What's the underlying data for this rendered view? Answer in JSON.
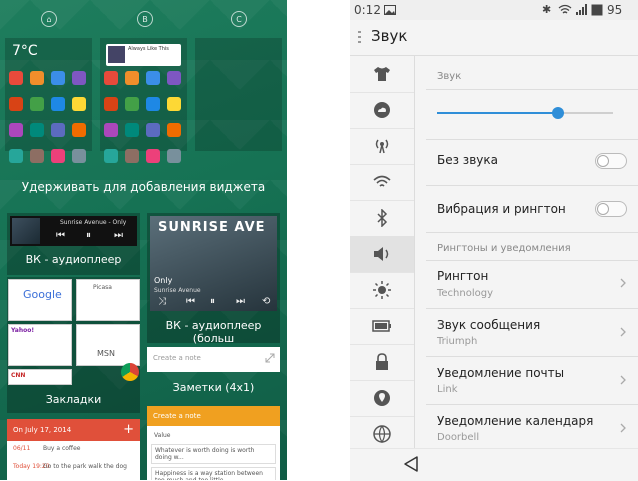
{
  "launcher": {
    "screens": [
      "⌂",
      "B",
      "C"
    ],
    "home_clock": "7°C",
    "mini_widget_text": "Always Like This",
    "hold_hint": "Удерживать для добавления виджета",
    "vk_small": {
      "track": "Sunrise Avenue - Only",
      "label": "ВК - аудиоплеер"
    },
    "vk_big": {
      "album": "SUNRISE AVE",
      "title": "Only",
      "artist": "Sunrise Avenue",
      "label": "ВК - аудиоплеер (больш"
    },
    "bookmarks": {
      "label": "Закладки",
      "items": [
        "Google",
        "Picasa",
        "Yahoo!",
        "MSN",
        "CNN"
      ]
    },
    "notes_small": {
      "placeholder": "Create a note",
      "label": "Заметки (4х1)"
    },
    "notes_big": {
      "header": "Create a note",
      "items": [
        "Value",
        "Whatever is worth doing is worth doing w...",
        "Happiness is a way station between too much and too little"
      ]
    },
    "calendar": {
      "header": "On July 17, 2014",
      "events": [
        {
          "date": "06/11",
          "text": "Buy a coffee"
        },
        {
          "date": "Today 19:20",
          "text": "Go to the park walk the dog"
        }
      ]
    },
    "mini_icon_colors": [
      "#e84a3b",
      "#f08e2b",
      "#3b8ee8",
      "#7e57c2",
      "#d84315",
      "#43a047",
      "#1e88e5",
      "#fdd835",
      "#ab47bc",
      "#00897b",
      "#5c6bc0",
      "#ef6c00",
      "#26a69a",
      "#8d6e63",
      "#ec407a",
      "#78909c"
    ]
  },
  "settings": {
    "status": {
      "time": "0:12",
      "battery": "95"
    },
    "title": "Звук",
    "categories": [
      "shirt-icon",
      "cloud-icon",
      "hotspot-icon",
      "wifi-icon",
      "bluetooth-icon",
      "speaker-icon",
      "brightness-icon",
      "battery-icon",
      "lock-icon",
      "location-icon",
      "globe-icon"
    ],
    "sound_section": "Звук",
    "volume": 0.69,
    "silent_label": "Без звука",
    "vibrate_label": "Вибрация и рингтон",
    "ring_section": "Рингтоны и уведомления",
    "items": [
      {
        "title": "Рингтон",
        "value": "Technology"
      },
      {
        "title": "Звук сообщения",
        "value": "Triumph"
      },
      {
        "title": "Уведомление почты",
        "value": "Link"
      },
      {
        "title": "Уведомление календаря",
        "value": "Doorbell"
      }
    ],
    "accent": "#2f8ed8"
  }
}
